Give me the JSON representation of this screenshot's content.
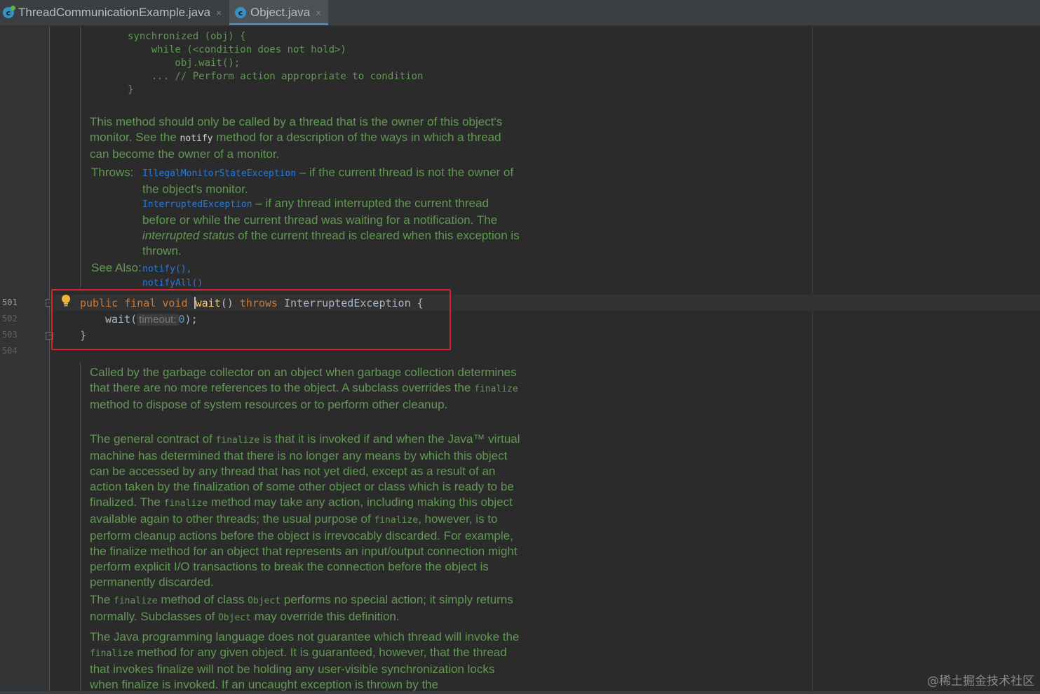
{
  "tabs": [
    {
      "label": "ThreadCommunicationExample.java",
      "icon": "class-icon",
      "active": false,
      "close": "×"
    },
    {
      "label": "Object.java",
      "icon": "class-icon",
      "active": true,
      "close": "×"
    }
  ],
  "code_sample": [
    "synchronized (obj) {",
    "    while (<condition does not hold>)",
    "        obj.wait();",
    "    ... // Perform action appropriate to condition",
    "}"
  ],
  "doc1": {
    "para_a": "This method should only be called by a thread that is the owner of this object's monitor. See the ",
    "para_code": "notify",
    "para_b": " method for a description of the ways in which a thread can become the owner of a monitor.",
    "throws_label": "Throws:",
    "ex1": "IllegalMonitorStateException",
    "ex1_text": " – if the current thread is not the owner of the object's monitor.",
    "ex2": "InterruptedException",
    "ex2_text_a": " – if any thread interrupted the current thread before or while the current thread was waiting for a notification. The ",
    "ex2_em": "interrupted status",
    "ex2_text_b": " of the current thread is cleared when this exception is thrown.",
    "see_also_label": "See Also:",
    "see1": "notify(),",
    "see2": "notifyAll()"
  },
  "source": {
    "line_numbers": [
      "501",
      "502",
      "503",
      "504"
    ],
    "kw_public": "public",
    "kw_final": "final",
    "kw_void": "void",
    "method": "wait",
    "parens": "()",
    "kw_throws": "throws",
    "exception": "InterruptedException",
    "brace": "{",
    "call": "wait(",
    "hint": "timeout:",
    "arg": "0",
    "call_end": ");",
    "close_brace": "}"
  },
  "doc2": {
    "p1_a": "Called by the garbage collector on an object when garbage collection determines that there are no more references to the object. A subclass overrides the ",
    "p1_code": "finalize",
    "p1_b": " method to dispose of system resources or to perform other cleanup.",
    "p2_a": "The general contract of ",
    "p2_code1": "finalize",
    "p2_b": " is that it is invoked if and when the Java™ virtual machine has determined that there is no longer any means by which this object can be accessed by any thread that has not yet died, except as a result of an action taken by the finalization of some other object or class which is ready to be finalized. The ",
    "p2_code2": "finalize",
    "p2_c": " method may take any action, including making this object available again to other threads; the usual purpose of ",
    "p2_code3": "finalize",
    "p2_d": ", however, is to perform cleanup actions before the object is irrevocably discarded. For example, the finalize method for an object that represents an input/output connection might perform explicit I/O transactions to break the connection before the object is permanently discarded.",
    "p3_a": "The ",
    "p3_code1": "finalize",
    "p3_b": " method of class ",
    "p3_code2": "Object",
    "p3_c": " performs no special action; it simply returns normally. Subclasses of ",
    "p3_code3": "Object",
    "p3_d": " may override this definition.",
    "p4_a": "The Java programming language does not guarantee which thread will invoke the ",
    "p4_code": "finalize",
    "p4_b": " method for any given object. It is guaranteed, however, that the thread that invokes finalize will not be holding any user-visible synchronization locks when finalize is invoked. If an uncaught exception is thrown by the"
  },
  "watermark": "@稀土掘金技术社区",
  "colors": {
    "background": "#2b2b2b",
    "doc_text": "#629755",
    "keyword": "#cc7832",
    "link": "#287bde",
    "highlight_box": "#d3282b"
  }
}
